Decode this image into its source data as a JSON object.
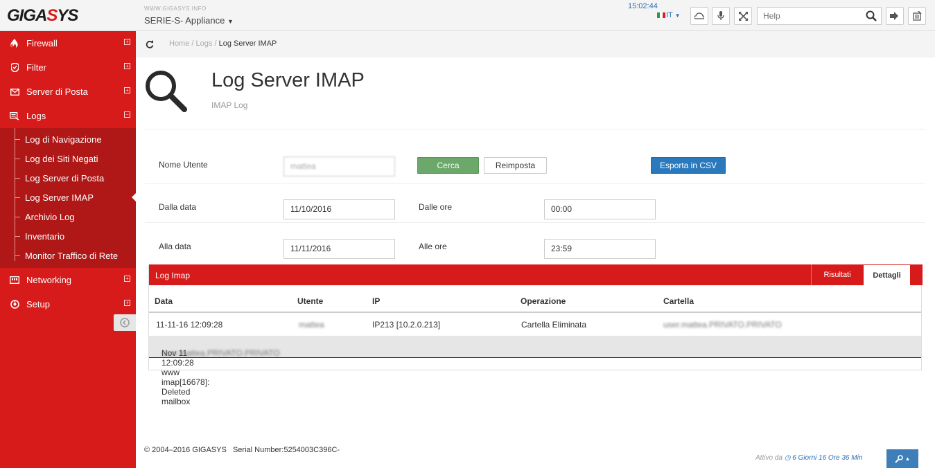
{
  "header": {
    "logo": "GIGASYS",
    "site_url": "WWW.GIGASYS.INFO",
    "appliance": "SERIE-S- Appliance",
    "clock": "15:02:44",
    "language": "IT",
    "help_placeholder": "Help"
  },
  "sidebar": {
    "items": [
      {
        "label": "Firewall",
        "icon": "fire-icon"
      },
      {
        "label": "Filter",
        "icon": "shield-icon"
      },
      {
        "label": "Server di Posta",
        "icon": "envelope-icon"
      },
      {
        "label": "Logs",
        "icon": "log-icon"
      },
      {
        "label": "Networking",
        "icon": "network-icon"
      },
      {
        "label": "Setup",
        "icon": "settings-icon"
      }
    ],
    "logs_submenu": [
      "Log di Navigazione",
      "Log dei Siti Negati",
      "Log Server di Posta",
      "Log Server IMAP",
      "Archivio Log",
      "Inventario",
      "Monitor Traffico di Rete"
    ]
  },
  "breadcrumb": [
    "Home",
    "Logs",
    "Log Server IMAP"
  ],
  "page": {
    "title": "Log Server IMAP",
    "subtitle": "IMAP Log"
  },
  "form": {
    "user_label": "Nome Utente",
    "user_value": "mattea",
    "search_button": "Cerca",
    "reset_button": "Reimposta",
    "export_button": "Esporta in CSV",
    "from_date_label": "Dalla data",
    "from_date_value": "11/10/2016",
    "from_time_label": "Dalle ore",
    "from_time_value": "00:00",
    "to_date_label": "Alla data",
    "to_date_value": "11/11/2016",
    "to_time_label": "Alle ore",
    "to_time_value": "23:59"
  },
  "log_panel": {
    "title": "Log Imap",
    "tabs": [
      "Risultati",
      "Dettagli"
    ],
    "columns": [
      "Data",
      "Utente",
      "IP",
      "Operazione",
      "Cartella"
    ],
    "rows": [
      {
        "data": "11-11-16 12:09:28",
        "utente": "mattea",
        "ip": "IP213 [10.2.0.213]",
        "operazione": "Cartella Eliminata",
        "cartella": "user.mattea.PRIVATO.PRIVATO"
      }
    ],
    "detail_prefix": "Nov 11 12:09:28 www imap[16678]: Deleted mailbox",
    "detail_blurred": "user.mattea.PRIVATO.PRIVATO"
  },
  "footer": {
    "copyright": "© 2004–2016 GIGASYS",
    "serial": "Serial Number:5254003C396C-",
    "uptime_prefix": "Attivo da",
    "uptime_value": "6 Giorni 16 Ore 36 Min"
  },
  "colors": {
    "brand_red": "#d71b1b",
    "submenu_red": "#b01818",
    "accent_blue": "#2b79bd",
    "search_green": "#6ba86a"
  }
}
